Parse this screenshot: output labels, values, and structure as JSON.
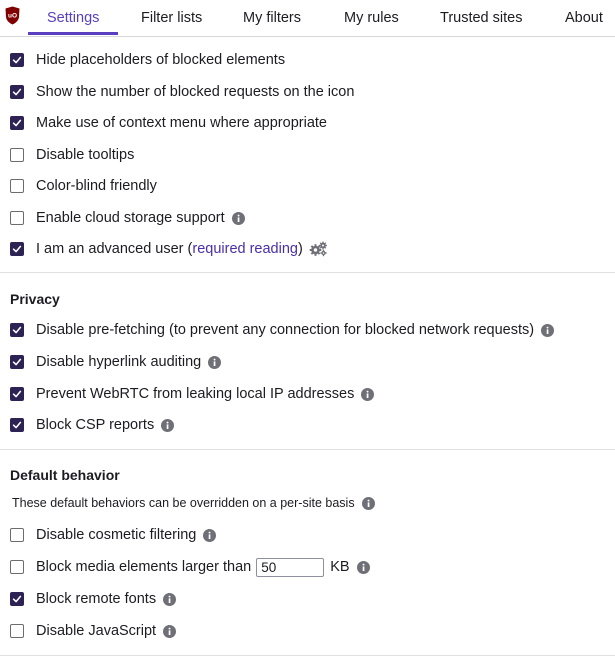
{
  "tabs": {
    "settings": "Settings",
    "filter_lists": "Filter lists",
    "my_filters": "My filters",
    "my_rules": "My rules",
    "trusted_sites": "Trusted sites",
    "about": "About"
  },
  "general": {
    "hide_placeholders": {
      "label": "Hide placeholders of blocked elements",
      "checked": true
    },
    "show_count": {
      "label": "Show the number of blocked requests on the icon",
      "checked": true
    },
    "context_menu": {
      "label": "Make use of context menu where appropriate",
      "checked": true
    },
    "disable_tooltips": {
      "label": "Disable tooltips",
      "checked": false
    },
    "color_blind": {
      "label": "Color-blind friendly",
      "checked": false
    },
    "cloud_storage": {
      "label": "Enable cloud storage support",
      "checked": false
    },
    "advanced_user": {
      "label": "I am an advanced user (",
      "link": "required reading",
      "label_end": ")",
      "checked": true
    }
  },
  "privacy": {
    "title": "Privacy",
    "prefetching": {
      "label": "Disable pre-fetching (to prevent any connection for blocked network requests)",
      "checked": true
    },
    "hyperlink_auditing": {
      "label": "Disable hyperlink auditing",
      "checked": true
    },
    "webrtc": {
      "label": "Prevent WebRTC from leaking local IP addresses",
      "checked": true
    },
    "csp_reports": {
      "label": "Block CSP reports",
      "checked": true
    }
  },
  "default_behavior": {
    "title": "Default behavior",
    "note": "These default behaviors can be overridden on a per-site basis",
    "cosmetic": {
      "label": "Disable cosmetic filtering",
      "checked": false
    },
    "media": {
      "label": "Block media elements larger than",
      "value": "50",
      "unit": "KB",
      "checked": false
    },
    "remote_fonts": {
      "label": "Block remote fonts",
      "checked": true
    },
    "javascript": {
      "label": "Disable JavaScript",
      "checked": false
    }
  },
  "icons": [
    "ublock-logo-icon",
    "info-icon",
    "gears-icon",
    "checkmark-icon"
  ],
  "colors": {
    "accent": "#5a3fc0",
    "checkbox_checked": "#2e2255",
    "link": "#4a2fa8"
  }
}
